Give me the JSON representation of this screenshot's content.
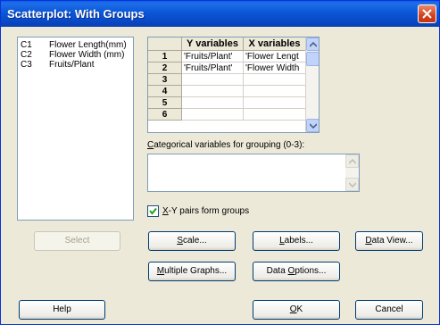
{
  "window": {
    "title": "Scatterplot: With Groups"
  },
  "variables": [
    {
      "num": "C1",
      "name": "Flower Length(mm)"
    },
    {
      "num": "C2",
      "name": "Flower Width (mm)"
    },
    {
      "num": "C3",
      "name": "Fruits/Plant"
    }
  ],
  "grid": {
    "headers": [
      "Y variables",
      "X variables"
    ],
    "rows": [
      {
        "n": "1",
        "y": "'Fruits/Plant'",
        "x": "'Flower Lengt"
      },
      {
        "n": "2",
        "y": "'Fruits/Plant'",
        "x": "'Flower Width"
      },
      {
        "n": "3",
        "y": "",
        "x": ""
      },
      {
        "n": "4",
        "y": "",
        "x": ""
      },
      {
        "n": "5",
        "y": "",
        "x": ""
      },
      {
        "n": "6",
        "y": "",
        "x": ""
      }
    ]
  },
  "categorical": {
    "label_first": "C",
    "label_rest": "ategorical variables for grouping (0-3):",
    "value": ""
  },
  "xy_pairs": {
    "label_first": "X",
    "label_rest": "-Y pairs form groups",
    "checked": true
  },
  "buttons": {
    "select": "Select",
    "scale_u": "S",
    "scale_rest": "cale...",
    "labels_u": "L",
    "labels_rest": "abels...",
    "dataview_u": "D",
    "dataview_rest": "ata View...",
    "multiple_u": "M",
    "multiple_rest": "ultiple Graphs...",
    "dataopt_pre": "Data ",
    "dataopt_u": "O",
    "dataopt_rest": "ptions...",
    "help": "Help",
    "ok_u": "O",
    "ok_rest": "K",
    "cancel": "Cancel"
  }
}
